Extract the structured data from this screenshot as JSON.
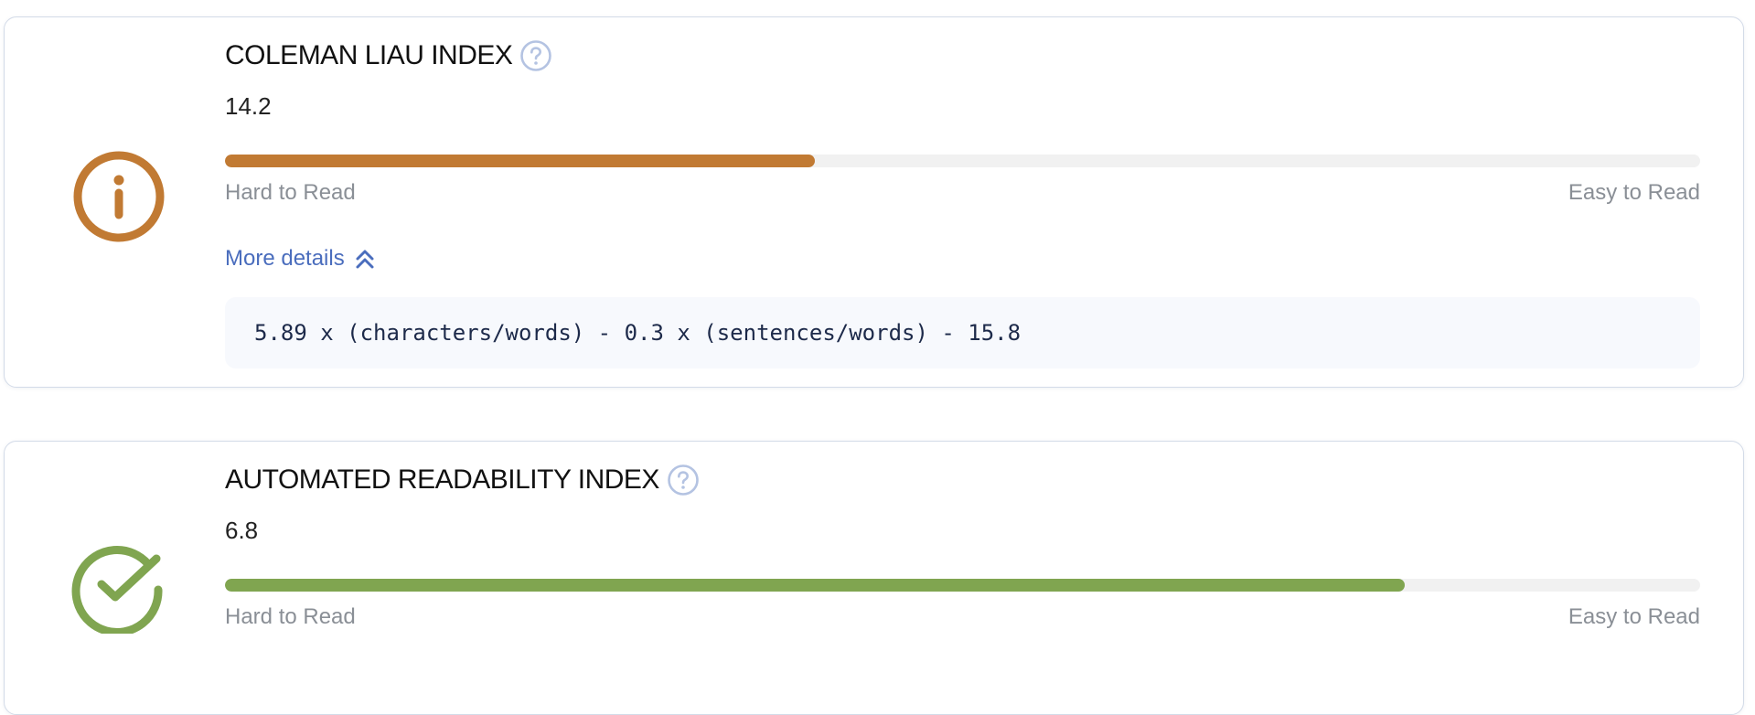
{
  "colors": {
    "warning": "#c17a33",
    "success": "#80a550",
    "help_icon": "#b4c3e2",
    "link": "#4a6dbd"
  },
  "metrics": [
    {
      "title": "COLEMAN LIAU INDEX",
      "score": "14.2",
      "status_icon": "info-circle-icon",
      "progress_fraction": 0.4,
      "scale_left": "Hard to Read",
      "scale_right": "Easy to Read",
      "more_details_label": "More details",
      "formula": "5.89 x (characters/words) - 0.3 x (sentences/words) - 15.8"
    },
    {
      "title": "AUTOMATED READABILITY INDEX",
      "score": "6.8",
      "status_icon": "check-circle-icon",
      "progress_fraction": 0.8,
      "scale_left": "Hard to Read",
      "scale_right": "Easy to Read"
    }
  ]
}
